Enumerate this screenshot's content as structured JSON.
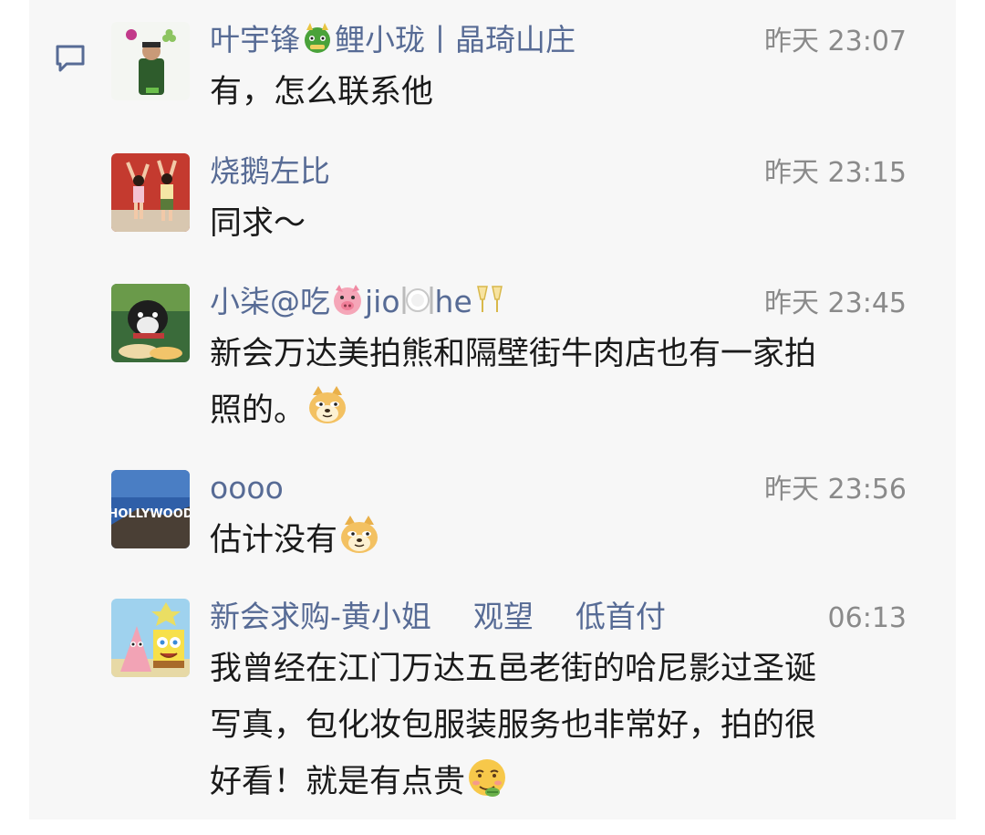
{
  "comments": [
    {
      "name_a": "叶宇锋",
      "name_b": "鲤小珑丨晶琦山庄",
      "time": "昨天 23:07",
      "text": "有，怎么联系他",
      "emoji": "dragon-face"
    },
    {
      "name": "烧鹅左比",
      "time": "昨天 23:15",
      "text": "同求～"
    },
    {
      "name_a": "小柒@吃",
      "name_b": "jio",
      "name_c": "he",
      "time": "昨天 23:45",
      "text_line1": "新会万达美拍熊和隔壁街牛肉店也有一家拍",
      "text_line2": "照的。",
      "emojis": [
        "pig-face",
        "plate-cutlery",
        "clinking-glasses",
        "doge-face"
      ]
    },
    {
      "name": "oooo",
      "time": "昨天 23:56",
      "text": "估计没有",
      "avatar_text": "HOLLYWOOD",
      "emoji": "doge-face"
    },
    {
      "name_a": "新会求购-黄小姐",
      "name_b": "观望",
      "name_c": "低首付",
      "time": "06:13",
      "text_line1": "我曾经在江门万达五邑老街的哈尼影过圣诞",
      "text_line2": "写真，包化妆包服装服务也非常好，拍的很",
      "text_line3": "好看！就是有点贵",
      "emoji": "smirk-face"
    }
  ],
  "colors": {
    "name": "#576b95",
    "time": "#8a8a8a",
    "text": "#1a1a1a",
    "panel": "#f7f7f7"
  },
  "icons": {
    "comment": "comment-icon"
  }
}
